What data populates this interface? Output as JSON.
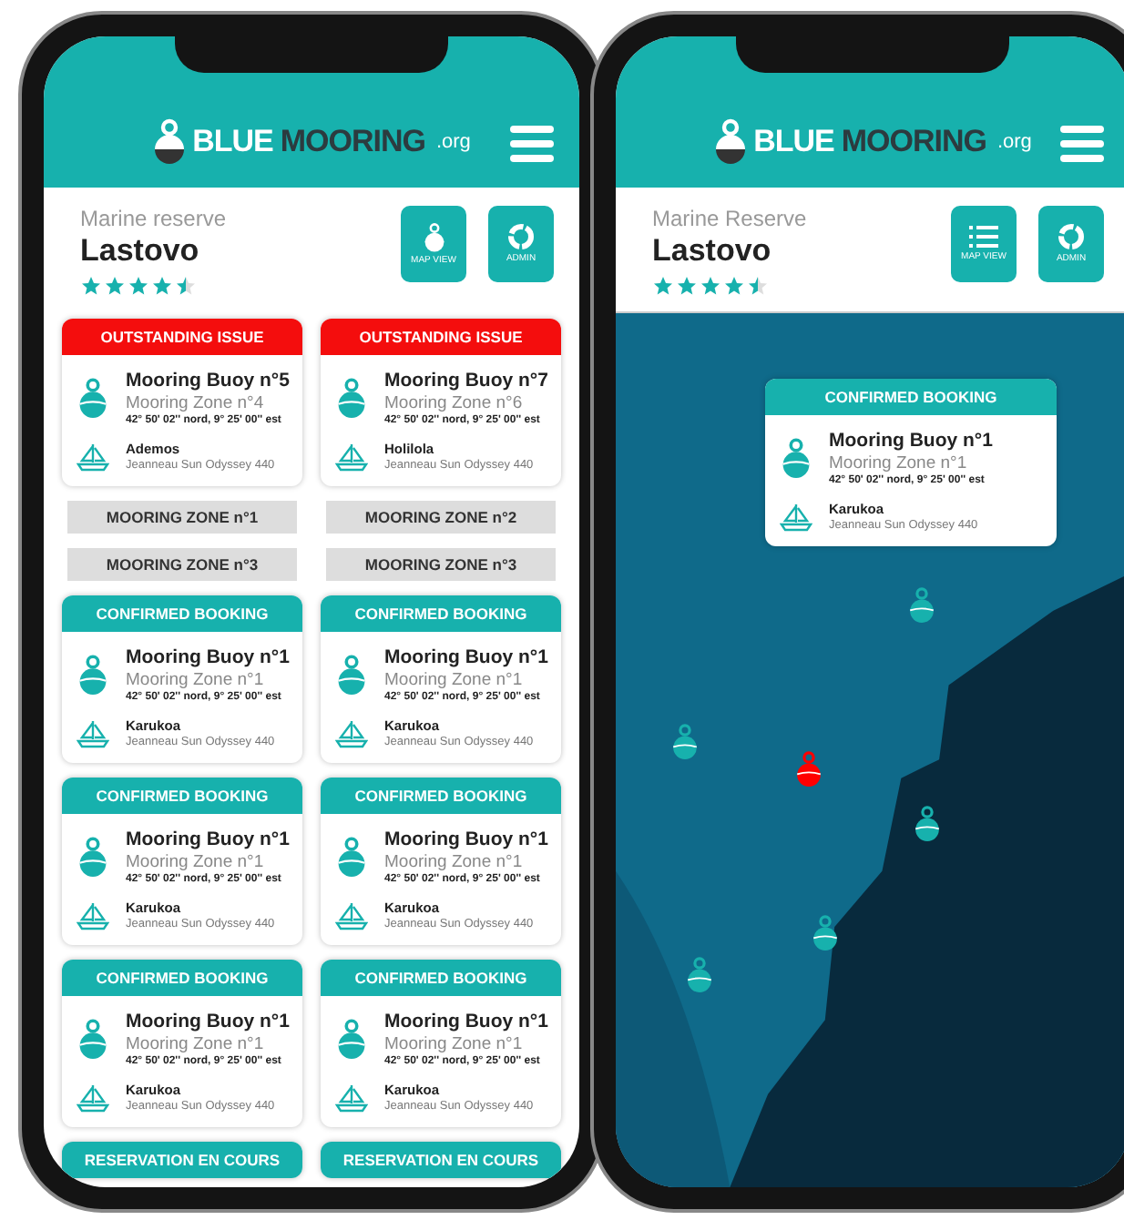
{
  "phones": [
    {
      "kind": "list",
      "logo": {
        "first": "BLUE",
        "second": "MOORING",
        "suffix": ".org"
      },
      "reserve": {
        "label": "Marine reserve",
        "name": "Lastovo",
        "stars": 4.5
      },
      "buttons": [
        {
          "kind": "buoy",
          "label": "MAP VIEW"
        },
        {
          "kind": "admin",
          "label": "ADMIN"
        }
      ],
      "items": [
        {
          "kind": "issue",
          "heading": "OUTSTANDING ISSUE",
          "buoy": "Mooring Buoy n°5",
          "zone": "Mooring Zone n°4",
          "coords": "42° 50' 02'' nord, 9° 25' 00'' est",
          "boat": "Ademos",
          "model": "Jeanneau Sun Odyssey 440"
        },
        {
          "kind": "issue",
          "heading": "OUTSTANDING ISSUE",
          "buoy": "Mooring Buoy n°7",
          "zone": "Mooring Zone n°6",
          "coords": "42° 50' 02'' nord, 9° 25' 00'' est",
          "boat": "Holilola",
          "model": "Jeanneau Sun Odyssey 440"
        },
        {
          "kind": "zone",
          "label": "MOORING ZONE n°1"
        },
        {
          "kind": "zone",
          "label": "MOORING ZONE n°2"
        },
        {
          "kind": "zone",
          "label": "MOORING ZONE n°3"
        },
        {
          "kind": "zone",
          "label": "MOORING ZONE n°3"
        },
        {
          "kind": "confirmed",
          "heading": "CONFIRMED BOOKING",
          "buoy": "Mooring Buoy n°1",
          "zone": "Mooring Zone n°1",
          "coords": "42° 50' 02'' nord, 9° 25' 00'' est",
          "boat": "Karukoa",
          "model": "Jeanneau Sun Odyssey 440"
        },
        {
          "kind": "confirmed",
          "heading": "CONFIRMED BOOKING",
          "buoy": "Mooring Buoy n°1",
          "zone": "Mooring Zone n°1",
          "coords": "42° 50' 02'' nord, 9° 25' 00'' est",
          "boat": "Karukoa",
          "model": "Jeanneau Sun Odyssey 440"
        },
        {
          "kind": "confirmed",
          "heading": "CONFIRMED BOOKING",
          "buoy": "Mooring Buoy n°1",
          "zone": "Mooring Zone n°1",
          "coords": "42° 50' 02'' nord, 9° 25' 00'' est",
          "boat": "Karukoa",
          "model": "Jeanneau Sun Odyssey 440"
        },
        {
          "kind": "confirmed",
          "heading": "CONFIRMED BOOKING",
          "buoy": "Mooring Buoy n°1",
          "zone": "Mooring Zone n°1",
          "coords": "42° 50' 02'' nord, 9° 25' 00'' est",
          "boat": "Karukoa",
          "model": "Jeanneau Sun Odyssey 440"
        },
        {
          "kind": "confirmed",
          "heading": "CONFIRMED BOOKING",
          "buoy": "Mooring Buoy n°1",
          "zone": "Mooring Zone n°1",
          "coords": "42° 50' 02'' nord, 9° 25' 00'' est",
          "boat": "Karukoa",
          "model": "Jeanneau Sun Odyssey 440"
        },
        {
          "kind": "confirmed",
          "heading": "CONFIRMED BOOKING",
          "buoy": "Mooring Buoy n°1",
          "zone": "Mooring Zone n°1",
          "coords": "42° 50' 02'' nord, 9° 25' 00'' est",
          "boat": "Karukoa",
          "model": "Jeanneau Sun Odyssey 440"
        },
        {
          "kind": "pending",
          "heading": "RESERVATION EN COURS"
        },
        {
          "kind": "pending",
          "heading": "RESERVATION EN COURS"
        }
      ]
    },
    {
      "kind": "map",
      "logo": {
        "first": "BLUE",
        "second": "MOORING",
        "suffix": ".org"
      },
      "reserve": {
        "label": "Marine Reserve",
        "name": "Lastovo",
        "stars": 4.5
      },
      "buttons": [
        {
          "kind": "list",
          "label": "MAP VIEW"
        },
        {
          "kind": "admin",
          "label": "ADMIN"
        }
      ],
      "popup": {
        "heading": "CONFIRMED BOOKING",
        "buoy": "Mooring Buoy n°1",
        "zone": "Mooring Zone n°1",
        "coords": "42° 50' 02'' nord, 9° 25' 00'' est",
        "boat": "Karukoa",
        "model": "Jeanneau Sun Odyssey 440"
      },
      "pins": [
        {
          "alert": false
        },
        {
          "alert": false
        },
        {
          "alert": true
        },
        {
          "alert": false
        },
        {
          "alert": false
        },
        {
          "alert": false
        }
      ]
    }
  ]
}
